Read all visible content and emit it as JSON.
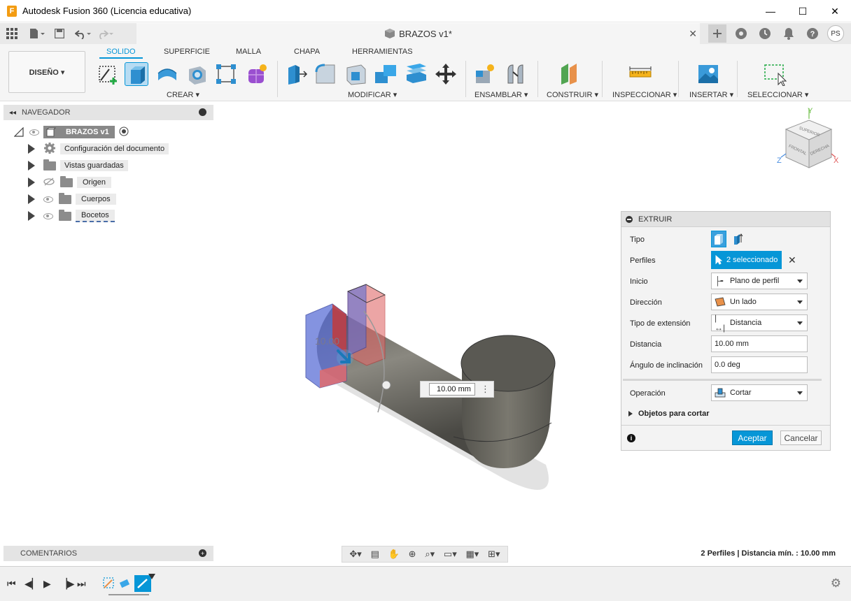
{
  "window": {
    "title": "Autodesk Fusion 360 (Licencia educativa)",
    "logo_letter": "F",
    "minimize": "—",
    "maximize": "☐",
    "close": "✕"
  },
  "appbar": {
    "document_tab": "BRAZOS v1*",
    "tab_close": "✕",
    "avatar_initials": "PS"
  },
  "ribbon": {
    "workspace": "DISEÑO ▾",
    "tabs": [
      "SOLIDO",
      "SUPERFICIE",
      "MALLA",
      "CHAPA",
      "HERRAMIENTAS"
    ],
    "groups": [
      "CREAR ▾",
      "MODIFICAR ▾",
      "ENSAMBLAR ▾",
      "CONSTRUIR ▾",
      "INSPECCIONAR ▾",
      "INSERTAR ▾",
      "SELECCIONAR ▾"
    ]
  },
  "navigator": {
    "title": "NAVEGADOR",
    "root": "BRAZOS v1",
    "items": [
      {
        "label": "Configuración del documento"
      },
      {
        "label": "Vistas guardadas"
      },
      {
        "label": "Origen"
      },
      {
        "label": "Cuerpos"
      },
      {
        "label": "Bocetos"
      }
    ]
  },
  "comments": {
    "title": "COMENTARIOS"
  },
  "viewcube": {
    "top": "SUPERIOR",
    "front": "FRONTAL",
    "right": "DERECHA",
    "axis_y": "Y",
    "axis_x": "X",
    "axis_z": "Z"
  },
  "viewport": {
    "ghost_dimension": "10.00",
    "dimension_input": "10.00 mm"
  },
  "extrude_panel": {
    "title": "EXTRUIR",
    "rows": {
      "tipo": "Tipo",
      "perfiles": "Perfiles",
      "perfiles_value": "2 seleccionado",
      "inicio": "Inicio",
      "inicio_value": "Plano de perfil",
      "direccion": "Dirección",
      "direccion_value": "Un lado",
      "tipo_extension": "Tipo de extensión",
      "tipo_extension_value": "Distancia",
      "distancia": "Distancia",
      "distancia_value": "10.00 mm",
      "angulo": "Ángulo de inclinación",
      "angulo_value": "0.0 deg",
      "operacion": "Operación",
      "operacion_value": "Cortar",
      "objetos": "Objetos para cortar"
    },
    "ok": "Aceptar",
    "cancel": "Cancelar"
  },
  "status": {
    "text": "2 Perfiles | Distancia mín. : 10.00 mm"
  },
  "colors": {
    "accent": "#0696d7",
    "body": "#6b6a64",
    "profile_blue": "#5b6fd6",
    "profile_red": "#e06a6a"
  }
}
